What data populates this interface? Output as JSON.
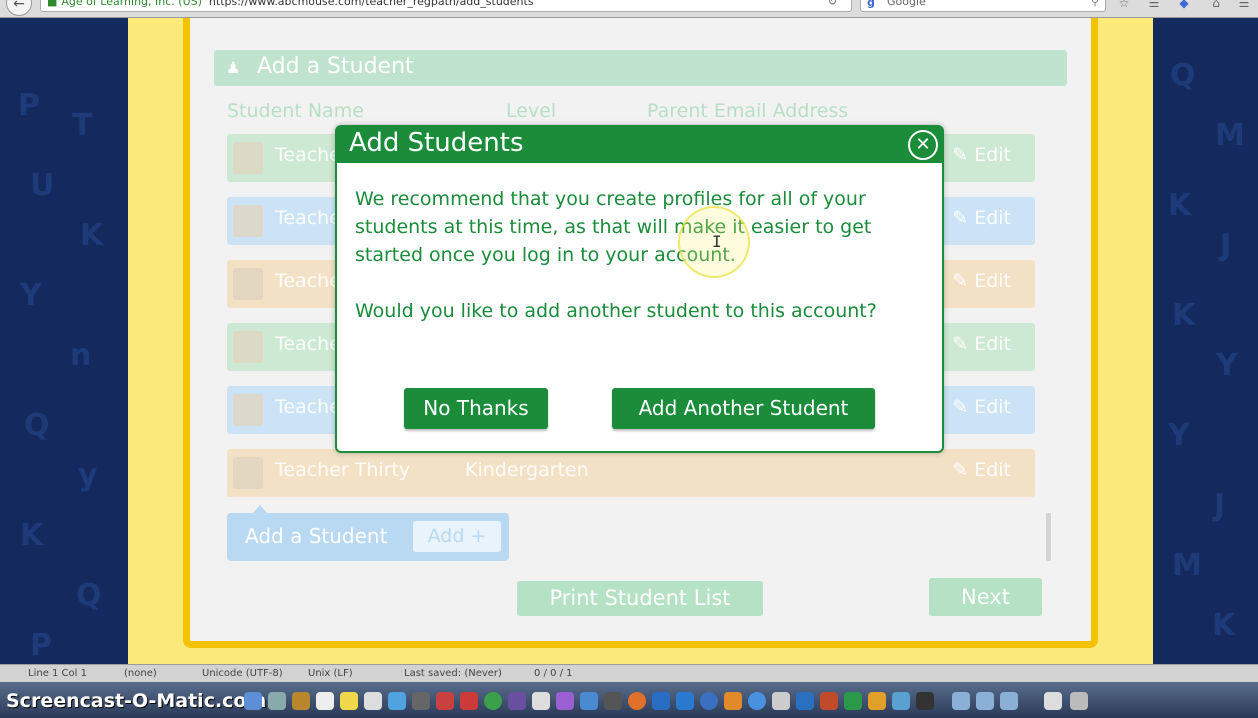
{
  "browser": {
    "site_label": "Age of Learning, Inc. (US)",
    "url": "https://www.abcmouse.com/teacher_regpath/add_students",
    "search_placeholder": "Google"
  },
  "page": {
    "section_title": "Add a Student",
    "columns": [
      "Student Name",
      "Level",
      "Parent Email Address"
    ],
    "rows": [
      {
        "name": "Teacher Twenty",
        "level": "",
        "edit": "Edit"
      },
      {
        "name": "Teacher Twenty",
        "level": "",
        "edit": "Edit"
      },
      {
        "name": "Teacher Twenty",
        "level": "",
        "edit": "Edit"
      },
      {
        "name": "Teacher Twenty",
        "level": "",
        "edit": "Edit"
      },
      {
        "name": "Teacher Twenty",
        "level": "",
        "edit": "Edit"
      },
      {
        "name": "Teacher Thirty",
        "level": "Kindergarten",
        "edit": "Edit"
      }
    ],
    "add_student_label": "Add a Student",
    "add_button": "Add +",
    "print_button": "Print Student List",
    "next_button": "Next"
  },
  "modal": {
    "title": "Add Students",
    "paragraph1": "We recommend that you create profiles for all of your students at this time, as that will make it easier to get started once you log in to your account.",
    "paragraph2": "Would you like to add another student to this account?",
    "no_button": "No Thanks",
    "add_button": "Add Another Student"
  },
  "status_bar": {
    "position": "Line 1 Col 1",
    "language": "(none)",
    "encoding": "Unicode (UTF-8)",
    "line_endings": "Unix (LF)",
    "saved": "Last saved: (Never)",
    "counts": "0 / 0 / 1"
  },
  "dock": {
    "watermark": "Screencast-O-Matic.com"
  }
}
